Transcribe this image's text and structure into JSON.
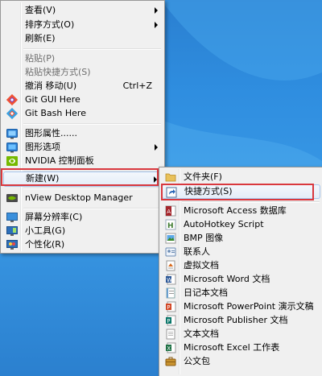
{
  "main_menu": {
    "items": [
      {
        "label": "查看(V)",
        "submenu": true
      },
      {
        "label": "排序方式(O)",
        "submenu": true
      },
      {
        "label": "刷新(E)"
      },
      {
        "label": "粘贴(P)",
        "disabled": true
      },
      {
        "label": "粘贴快捷方式(S)",
        "disabled": true
      },
      {
        "label": "撤消 移动(U)",
        "shortcut": "Ctrl+Z"
      },
      {
        "label": "Git GUI Here",
        "icon": "git-gui-icon"
      },
      {
        "label": "Git Bash Here",
        "icon": "git-bash-icon"
      },
      {
        "label": "图形属性......",
        "icon": "graphics-properties-icon"
      },
      {
        "label": "图形选项",
        "icon": "graphics-options-icon",
        "submenu": true
      },
      {
        "label": "NVIDIA 控制面板",
        "icon": "nvidia-icon"
      },
      {
        "label": "新建(W)",
        "submenu": true,
        "highlighted": true
      },
      {
        "label": "nView Desktop Manager",
        "icon": "nview-icon"
      },
      {
        "label": "屏幕分辨率(C)",
        "icon": "screen-resolution-icon"
      },
      {
        "label": "小工具(G)",
        "icon": "gadgets-icon"
      },
      {
        "label": "个性化(R)",
        "icon": "personalize-icon"
      }
    ]
  },
  "new_submenu": {
    "items": [
      {
        "label": "文件夹(F)",
        "icon": "folder-icon"
      },
      {
        "label": "快捷方式(S)",
        "icon": "shortcut-icon",
        "highlighted": true
      },
      {
        "label": "Microsoft Access 数据库",
        "icon": "access-icon"
      },
      {
        "label": "AutoHotkey Script",
        "icon": "autohotkey-icon"
      },
      {
        "label": "BMP 图像",
        "icon": "bmp-image-icon"
      },
      {
        "label": "联系人",
        "icon": "contact-icon"
      },
      {
        "label": "虚拟文档",
        "icon": "virtual-document-icon"
      },
      {
        "label": "Microsoft Word 文档",
        "icon": "word-icon"
      },
      {
        "label": "日记本文档",
        "icon": "journal-icon"
      },
      {
        "label": "Microsoft PowerPoint 演示文稿",
        "icon": "powerpoint-icon"
      },
      {
        "label": "Microsoft Publisher 文档",
        "icon": "publisher-icon"
      },
      {
        "label": "文本文档",
        "icon": "text-document-icon"
      },
      {
        "label": "Microsoft Excel 工作表",
        "icon": "excel-icon"
      },
      {
        "label": "公文包",
        "icon": "briefcase-icon"
      }
    ]
  },
  "colors": {
    "highlight_box": "#d9383e",
    "menu_bg": "#f0f0f0",
    "desktop": "#2f8ee0"
  }
}
